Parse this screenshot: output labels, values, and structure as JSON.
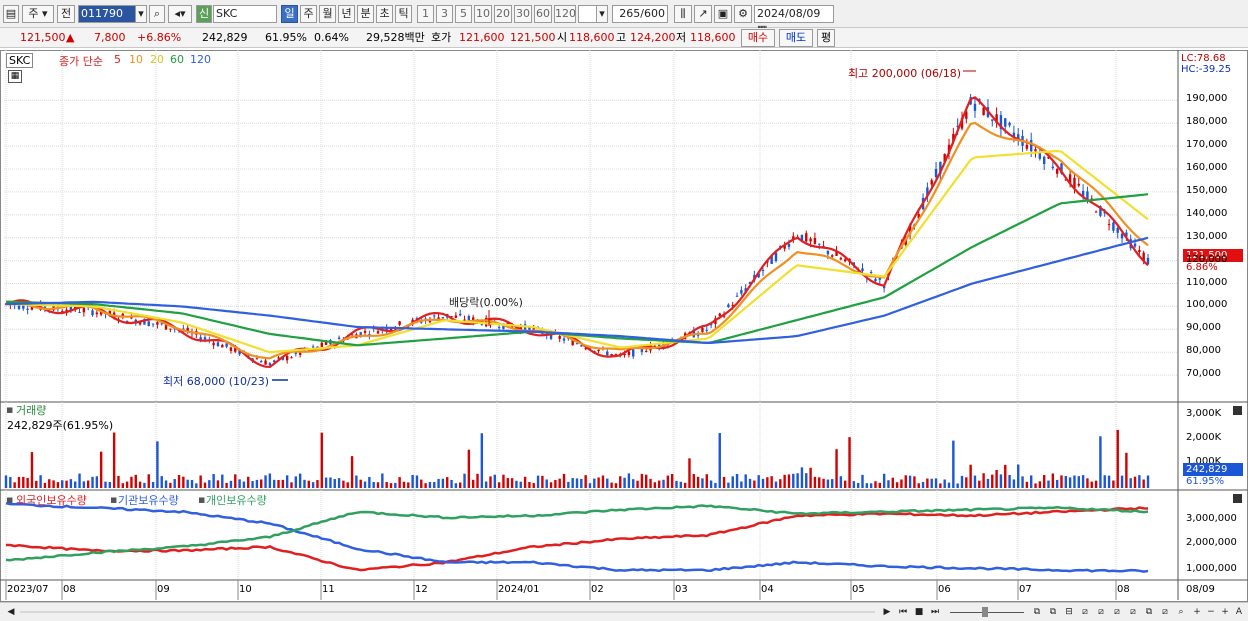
{
  "toolbar": {
    "type_label": "주",
    "prev_label": "전",
    "stock_code": "011790",
    "badge": "신",
    "stock_name": "SKC",
    "periods": [
      "일",
      "주",
      "월",
      "년",
      "분",
      "초",
      "틱"
    ],
    "intervals": [
      "1",
      "3",
      "5",
      "10",
      "20",
      "30",
      "60",
      "120"
    ],
    "count": "265",
    "count_max": "/600",
    "date": "2024/08/09"
  },
  "quote": {
    "price": "121,500",
    "up_arrow": "▲",
    "change": "7,800",
    "change_pct": "+6.86%",
    "volume": "242,829",
    "volume_ratio": "61.95%",
    "turnover": "0.64%",
    "amount": "29,528백만",
    "ask_label": "호가",
    "ask1": "121,600",
    "bid1": "121,500",
    "open_label": "시",
    "open": "118,600",
    "high_label": "고",
    "high": "124,200",
    "low_label": "저",
    "low": "118,600",
    "buy": "매수",
    "sell": "매도",
    "eval": "평"
  },
  "legend": {
    "stock": "SKC",
    "ma_label": "종가 단순",
    "ma5": "5",
    "ma10": "10",
    "ma20": "20",
    "ma60": "60",
    "ma120": "120"
  },
  "annotations": {
    "high": "최고 200,000 (06/18)",
    "low": "최저 68,000 (10/23)",
    "dividend": "배당락(0.00%)",
    "lc": "LC:78.68",
    "hc": "HC:-39.25",
    "price_tag": "121,500",
    "pct_tag": "6.86%"
  },
  "volume_panel": {
    "title": "거래량",
    "info": "242,829주(61.95%)",
    "tag": "242,829",
    "tag_pct": "61.95%",
    "ticks": [
      "3,000K",
      "2,000K",
      "1,000K"
    ]
  },
  "holding_panel": {
    "foreign": "외국인보유수량",
    "inst": "기관보유수량",
    "indiv": "개인보유수량",
    "ticks": [
      "3,000,000",
      "2,000,000",
      "1,000,000"
    ]
  },
  "price_ticks": [
    "190,000",
    "180,000",
    "170,000",
    "160,000",
    "150,000",
    "140,000",
    "130,000",
    "120,000",
    "110,000",
    "100,000",
    "90,000",
    "80,000",
    "70,000"
  ],
  "x_labels": [
    "2023/07",
    "08",
    "09",
    "10",
    "11",
    "12",
    "2024/01",
    "02",
    "03",
    "04",
    "05",
    "06",
    "07",
    "08"
  ],
  "x_end": "08/09",
  "colors": {
    "up": "#d20000",
    "down": "#1a56d6",
    "ma5": "#e02020",
    "ma10": "#f09020",
    "ma20": "#f0e030",
    "ma60": "#20a040",
    "ma120": "#3060e0",
    "foreign": "#e02020",
    "inst": "#3060e0",
    "indiv": "#30a060"
  },
  "chart_data": {
    "type": "line",
    "x": [
      "2023/07",
      "08",
      "09",
      "10",
      "11",
      "12",
      "2024/01",
      "02",
      "03",
      "04",
      "05",
      "06",
      "07",
      "08"
    ],
    "series": [
      {
        "name": "5",
        "values": [
          101000,
          98000,
          90000,
          75000,
          88000,
          96000,
          90000,
          78000,
          90000,
          132000,
          110000,
          190000,
          160000,
          120000
        ]
      },
      {
        "name": "10",
        "values": [
          101000,
          99000,
          91000,
          77000,
          86000,
          95000,
          90000,
          80000,
          88000,
          125000,
          112000,
          180000,
          165000,
          127000
        ]
      },
      {
        "name": "20",
        "values": [
          101000,
          100000,
          93000,
          80000,
          83000,
          94000,
          91000,
          82000,
          86000,
          118000,
          113000,
          165000,
          168000,
          138000
        ]
      },
      {
        "name": "60",
        "values": [
          102000,
          101000,
          97000,
          88000,
          83000,
          86000,
          89000,
          86000,
          84000,
          94000,
          104000,
          126000,
          145000,
          149000
        ]
      },
      {
        "name": "120",
        "values": [
          101000,
          102000,
          100000,
          96000,
          91000,
          90000,
          89000,
          87000,
          84000,
          87000,
          96000,
          110000,
          120000,
          130000
        ]
      }
    ],
    "ylim": [
      60000,
      205000
    ]
  }
}
